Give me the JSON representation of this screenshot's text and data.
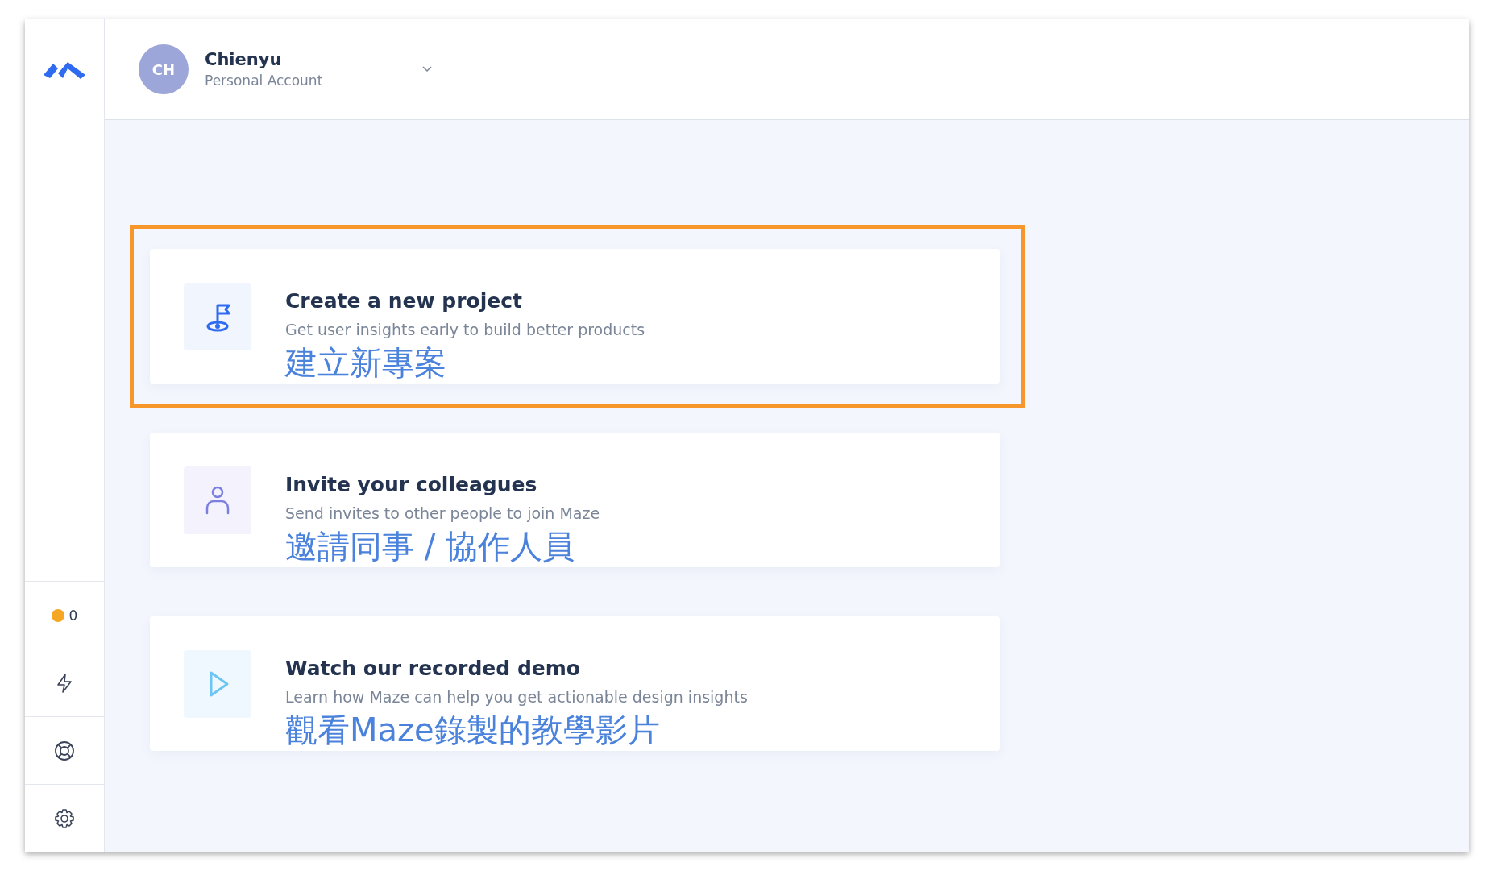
{
  "account": {
    "initials": "CH",
    "name": "Chienyu",
    "type": "Personal Account"
  },
  "sidebar": {
    "notifications": {
      "count": "0",
      "color": "#f5a623"
    }
  },
  "cards": [
    {
      "kind": "flag",
      "title": "Create a new project",
      "subtitle": "Get user insights early to build better products",
      "annotation": "建立新專案",
      "highlighted": true
    },
    {
      "kind": "person",
      "title": "Invite your colleagues",
      "subtitle": "Send invites to other people to join Maze",
      "annotation": "邀請同事 / 協作人員",
      "highlighted": false
    },
    {
      "kind": "play",
      "title": "Watch our recorded demo",
      "subtitle": "Learn how Maze can help you get actionable design insights",
      "annotation": "觀看Maze錄製的教學影片",
      "highlighted": false
    }
  ]
}
